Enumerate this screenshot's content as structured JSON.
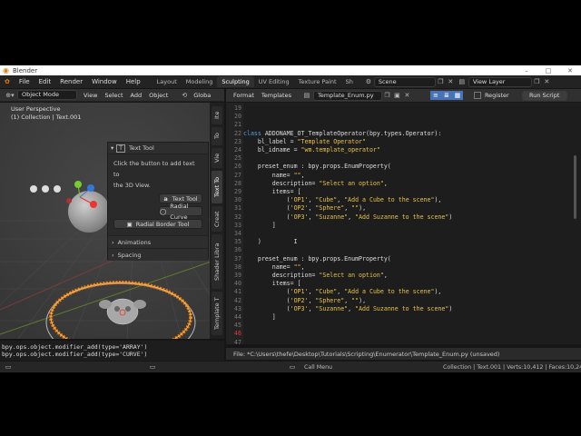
{
  "window": {
    "title": "Blender",
    "minimize": "–",
    "maximize": "□",
    "close": "✕"
  },
  "menu": [
    "File",
    "Edit",
    "Render",
    "Window",
    "Help"
  ],
  "workspaces": [
    "Layout",
    "Modeling",
    "Sculpting",
    "UV Editing",
    "Texture Paint",
    "Sh"
  ],
  "workspace_active": "Sculpting",
  "scene": "Scene",
  "view_layer": "View Layer",
  "viewport": {
    "mode": "Object Mode",
    "menu": [
      "View",
      "Select",
      "Add",
      "Object"
    ],
    "transform": "Globa",
    "overlay_text1": "User Perspective",
    "overlay_text2": "(1) Collection | Text.001",
    "vtabs": [
      "Ite",
      "To",
      "Vie",
      "Text To",
      "Creat",
      "Shader Libra",
      "Template T"
    ],
    "npanel": {
      "header": "Text Tool",
      "desc1": "Click the button to add text to",
      "desc2": "the 3D View.",
      "btn1": "Text Tool",
      "btn2": "Radial Curve",
      "btn3": "Radial Border Tool",
      "sec1": "Animations",
      "sec2": "Spacing"
    }
  },
  "info_log": [
    "bpy.ops.object.modifier_add(type='ARRAY')",
    "bpy.ops.object.modifier_add(type='CURVE')"
  ],
  "text_editor": {
    "menu": [
      "Format",
      "Templates"
    ],
    "filename": "Template_Enum.py",
    "register": "Register",
    "run": "Run Script",
    "lines": [
      {
        "n": "19",
        "t": ""
      },
      {
        "n": "20",
        "t": ""
      },
      {
        "n": "21",
        "t": ""
      },
      {
        "n": "22",
        "t": "class ADDONAME_OT_TemplateOperator(bpy.types.Operator):"
      },
      {
        "n": "23",
        "t": "    bl_label = \"Template Operator\""
      },
      {
        "n": "24",
        "t": "    bl_idname = \"wm.template_operator\""
      },
      {
        "n": "25",
        "t": ""
      },
      {
        "n": "26",
        "t": "    preset_enum : bpy.props.EnumProperty("
      },
      {
        "n": "27",
        "t": "        name= \"\","
      },
      {
        "n": "28",
        "t": "        description= \"Select an option\","
      },
      {
        "n": "29",
        "t": "        items= ["
      },
      {
        "n": "30",
        "t": "            ('OP1', \"Cube\", \"Add a Cube to the scene\"),"
      },
      {
        "n": "31",
        "t": "            ('OP2', \"Sphere\", \"\"),"
      },
      {
        "n": "32",
        "t": "            ('OP3', \"Suzanne\", \"Add Suzanne to the scene\")"
      },
      {
        "n": "33",
        "t": "        ]"
      },
      {
        "n": "34",
        "t": ""
      },
      {
        "n": "35",
        "t": "    )         I"
      },
      {
        "n": "36",
        "t": ""
      },
      {
        "n": "37",
        "t": "    preset_enum : bpy.props.EnumProperty("
      },
      {
        "n": "38",
        "t": "        name= \"\","
      },
      {
        "n": "39",
        "t": "        description= \"Select an option\","
      },
      {
        "n": "40",
        "t": "        items= ["
      },
      {
        "n": "41",
        "t": "            ('OP1', \"Cube\", \"Add a Cube to the scene\"),"
      },
      {
        "n": "42",
        "t": "            ('OP2', \"Sphere\", \"\"),"
      },
      {
        "n": "43",
        "t": "            ('OP3', \"Suzanne\", \"Add Suzanne to the scene\")"
      },
      {
        "n": "44",
        "t": "        ]"
      },
      {
        "n": "45",
        "t": ""
      },
      {
        "n": "46",
        "t": "    "
      },
      {
        "n": "47",
        "t": ""
      }
    ],
    "current_line": "46",
    "file_info": "File: *C:\\Users\\thefe\\Desktop\\Tutorials\\Scripting\\Enumerator\\Template_Enum.py (unsaved)"
  },
  "status": {
    "left": "",
    "mid": "Call Menu",
    "right": "Collection | Text.001 | Verts:10,412 | Faces:10,24"
  },
  "colors": {
    "accent": "#e87d0d",
    "keyword": "#56a0e0",
    "string": "#e8c24a"
  }
}
